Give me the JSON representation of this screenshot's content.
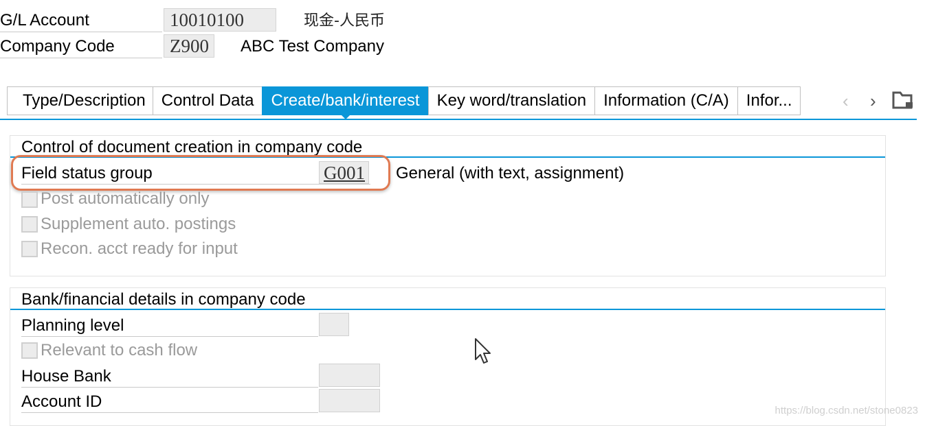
{
  "header": {
    "gl_account_label": "G/L Account",
    "gl_account_value": "10010100",
    "gl_account_desc": "现金-人民币",
    "company_code_label": "Company Code",
    "company_code_value": "Z900",
    "company_name": "ABC Test Company"
  },
  "tabs": [
    {
      "label": "Type/Description",
      "active": false
    },
    {
      "label": "Control Data",
      "active": false
    },
    {
      "label": "Create/bank/interest",
      "active": true
    },
    {
      "label": "Key word/translation",
      "active": false
    },
    {
      "label": "Information (C/A)",
      "active": false
    },
    {
      "label": "Infor...",
      "active": false
    }
  ],
  "tab_nav": {
    "prev_icon": "chevron-left-icon",
    "next_icon": "chevron-right-icon",
    "menu_icon": "tab-list-icon"
  },
  "doc_creation": {
    "title": "Control of document creation in company code",
    "field_status_label": "Field status group",
    "field_status_value": "G001",
    "field_status_desc": "General (with text, assignment)",
    "post_auto_label": "Post automatically only",
    "supplement_label": "Supplement auto. postings",
    "recon_label": "Recon. acct ready for input"
  },
  "bank": {
    "title": "Bank/financial details in company code",
    "planning_level_label": "Planning level",
    "cash_flow_label": "Relevant to cash flow",
    "house_bank_label": "House Bank",
    "account_id_label": "Account ID"
  },
  "watermark": "https://blog.csdn.net/stone0823",
  "colors": {
    "accent": "#0a96d8",
    "highlight": "#e07a52"
  }
}
